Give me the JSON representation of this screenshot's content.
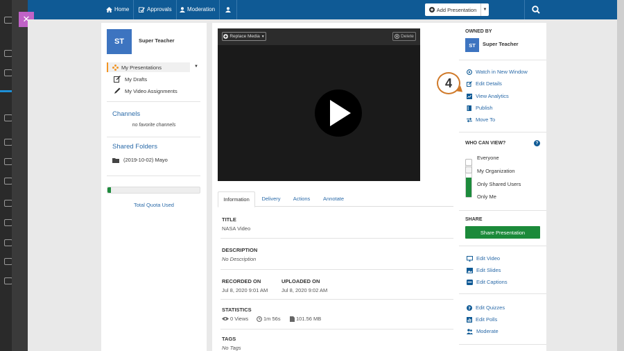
{
  "nav": {
    "home": "Home",
    "approvals": "Approvals",
    "moderation": "Moderation",
    "add_presentation": "Add Presentation"
  },
  "left": {
    "avatar_initials": "ST",
    "user_name": "Super Teacher",
    "my_presentations": "My Presentations",
    "my_drafts": "My Drafts",
    "my_video_assignments": "My Video Assignments",
    "channels_title": "Channels",
    "channels_empty": "no favorite channels",
    "shared_folders_title": "Shared Folders",
    "shared_folder_item": "(2019-10-02) Mayo",
    "quota_used_fraction": 0.04,
    "quota_label": "Total Quota Used"
  },
  "player": {
    "replace_media": "Replace Media",
    "delete": "Delete"
  },
  "tabs": [
    "Information",
    "Delivery",
    "Actions",
    "Annotate"
  ],
  "info": {
    "title_label": "TITLE",
    "title_value": "NASA Video",
    "description_label": "DESCRIPTION",
    "description_value": "No Description",
    "recorded_label": "RECORDED ON",
    "recorded_value": "Jul 8, 2020 9:01 AM",
    "uploaded_label": "UPLOADED ON",
    "uploaded_value": "Jul 8, 2020 9:02 AM",
    "statistics_label": "STATISTICS",
    "views": "0 Views",
    "duration": "1m 56s",
    "size": "101.56 MB",
    "tags_label": "TAGS",
    "tags_value": "No Tags"
  },
  "right": {
    "owned_by": "OWNED BY",
    "owner_initials": "ST",
    "owner_name": "Super Teacher",
    "watch_new_window": "Watch in New Window",
    "edit_details": "Edit Details",
    "view_analytics": "View Analytics",
    "publish": "Publish",
    "move_to": "Move To",
    "who_can_view": "WHO CAN VIEW?",
    "perm_everyone": "Everyone",
    "perm_org": "My Organization",
    "perm_shared": "Only Shared Users",
    "perm_me": "Only Me",
    "share_title": "SHARE",
    "share_presentation": "Share Presentation",
    "edit_video": "Edit Video",
    "edit_slides": "Edit Slides",
    "edit_captions": "Edit Captions",
    "edit_quizzes": "Edit Quizzes",
    "edit_polls": "Edit Polls",
    "moderate": "Moderate"
  },
  "callout": {
    "number": "4"
  },
  "colors": {
    "nav_blue": "#0f5a95",
    "link_blue": "#2a6aa8",
    "share_green": "#1b8a3a",
    "accent_orange": "#f29423",
    "close_purple": "#c063c7"
  }
}
